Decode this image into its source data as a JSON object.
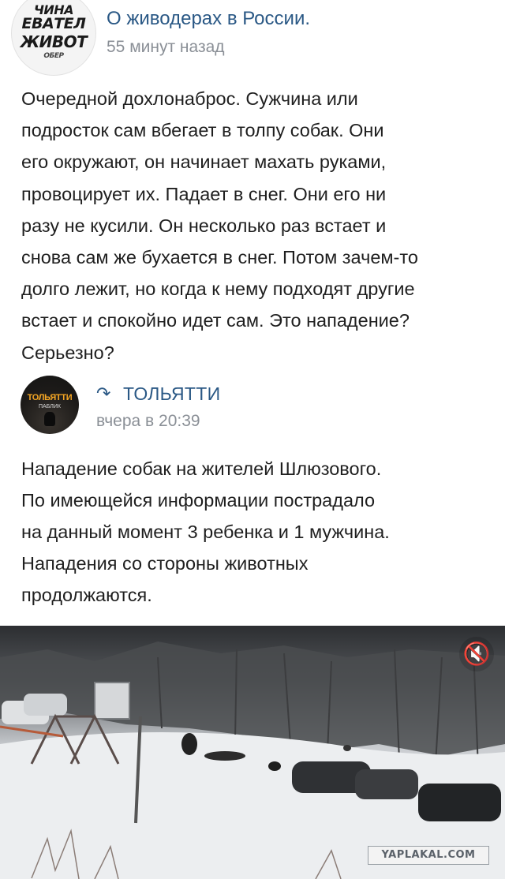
{
  "post": {
    "avatar_text": [
      "ЧИНА",
      "ЕВАТЕЛ",
      "ЖИВОТ",
      "ОБЕР"
    ],
    "group_name": "О живодерах в России.",
    "time": "55 минут назад",
    "text": "Очередной дохлонаброс. Сужчина или\nподросток сам вбегает в толпу собак. Они\nего окружают, он начинает махать руками,\nпровоцирует их. Падает в снег. Они его ни\nразу не кусили. Он несколько раз встает и\nснова сам же бухается в снег. Потом зачем-то\nдолго лежит, но когда к нему подходят другие\nвстает и спокойно идет сам. Это нападение?\nСерьезно?"
  },
  "repost": {
    "avatar_brand": "ТОЛЬЯТТИ",
    "avatar_sub": "ПАБЛИК",
    "icon": "repost-arrow-icon",
    "source": "ТОЛЬЯТТИ",
    "time": "вчера в 20:39",
    "text": "Нападение собак на жителей Шлюзового.\nПо имеющейся информации пострадало\nна данный момент 3 ребенка и 1 мужчина.\nНападения со стороны животных\nпродолжаются."
  },
  "video": {
    "mute_icon": "muted-speaker-icon"
  },
  "watermark": "YAPLAKAL.COM",
  "colors": {
    "link": "#2a5885",
    "meta": "#8a8f96",
    "text": "#1f1f1f"
  }
}
